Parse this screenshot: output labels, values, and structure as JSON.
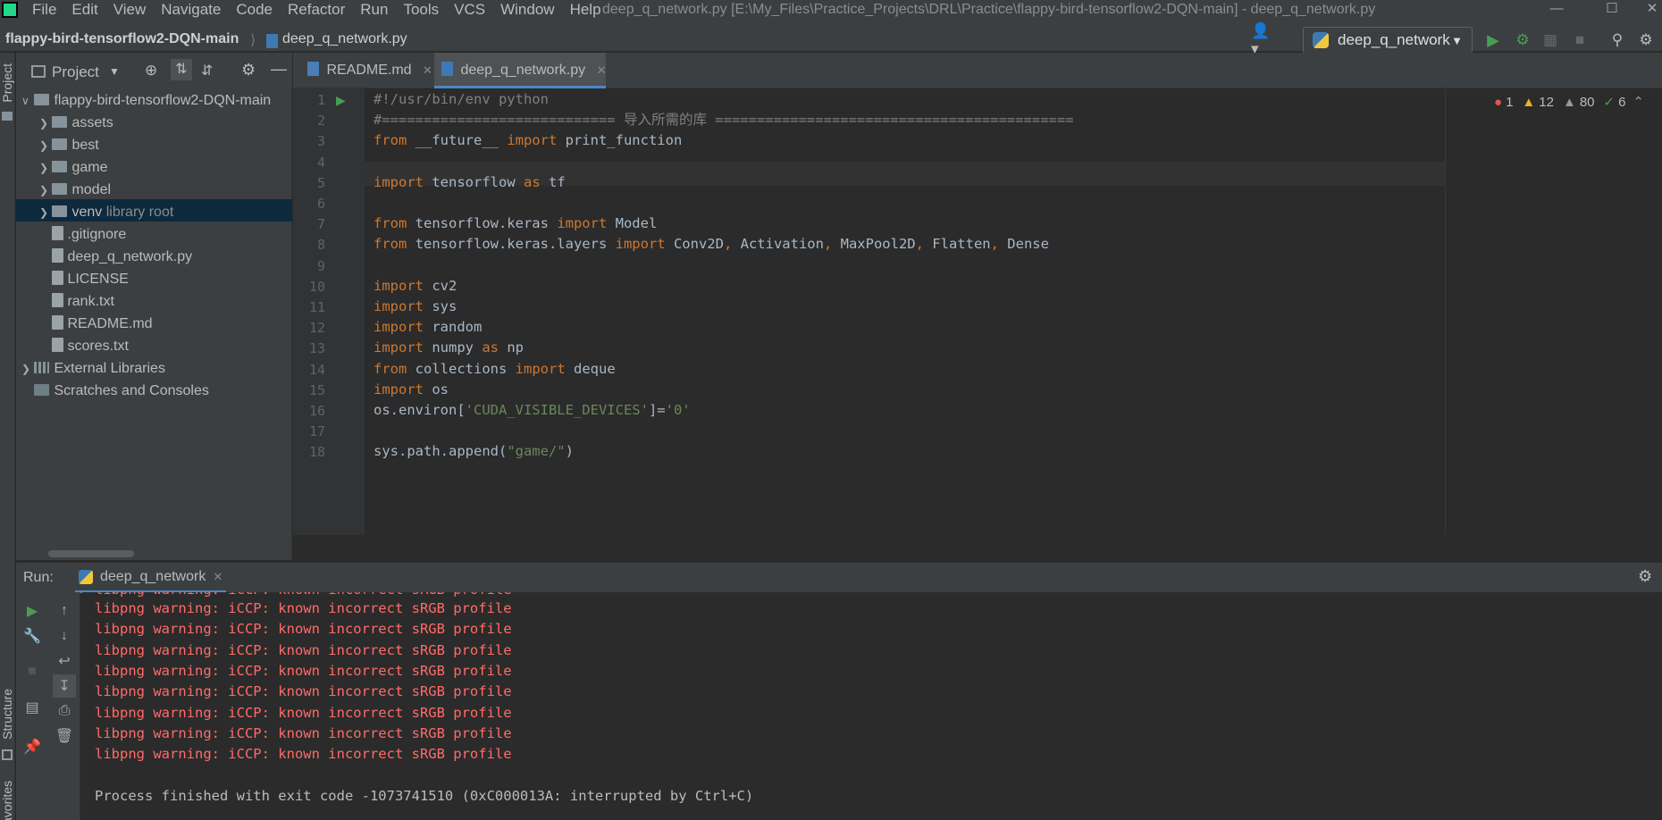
{
  "menu": {
    "items": [
      "File",
      "Edit",
      "View",
      "Navigate",
      "Code",
      "Refactor",
      "Run",
      "Tools",
      "VCS",
      "Window",
      "Help"
    ]
  },
  "window": {
    "title": "deep_q_network.py [E:\\My_Files\\Practice_Projects\\DRL\\Practice\\flappy-bird-tensorflow2-DQN-main] - deep_q_network.py"
  },
  "breadcrumb": {
    "project": "flappy-bird-tensorflow2-DQN-main",
    "file": "deep_q_network.py"
  },
  "toolbar": {
    "run_config": "deep_q_network"
  },
  "left_stripe": {
    "project_label": "Project",
    "structure_label": "Structure",
    "favorites_label": "Favorites"
  },
  "project_panel": {
    "title": "Project",
    "tree": [
      {
        "label": "flappy-bird-tensorflow2-DQN-main",
        "type": "folder",
        "depth": 0,
        "open": true
      },
      {
        "label": "assets",
        "type": "folder",
        "depth": 1
      },
      {
        "label": "best",
        "type": "folder",
        "depth": 1
      },
      {
        "label": "game",
        "type": "folder",
        "depth": 1
      },
      {
        "label": "model",
        "type": "folder",
        "depth": 1
      },
      {
        "label": "venv",
        "note": "library root",
        "type": "folder",
        "depth": 1,
        "selected": true
      },
      {
        "label": ".gitignore",
        "type": "file",
        "depth": 1
      },
      {
        "label": "deep_q_network.py",
        "type": "file",
        "depth": 1
      },
      {
        "label": "LICENSE",
        "type": "file",
        "depth": 1
      },
      {
        "label": "rank.txt",
        "type": "file",
        "depth": 1
      },
      {
        "label": "README.md",
        "type": "file",
        "depth": 1
      },
      {
        "label": "scores.txt",
        "type": "file",
        "depth": 1
      },
      {
        "label": "External Libraries",
        "type": "lib",
        "depth": 0
      },
      {
        "label": "Scratches and Consoles",
        "type": "scratch",
        "depth": 0
      }
    ]
  },
  "tabs": [
    {
      "label": "README.md",
      "active": false
    },
    {
      "label": "deep_q_network.py",
      "active": true
    }
  ],
  "inspections": {
    "errors": "1",
    "warnings": "12",
    "weak": "80",
    "ok": "6"
  },
  "editor": {
    "lines": [
      [
        [
          "#!/usr/bin/env python",
          "cm"
        ]
      ],
      [
        [
          "#============================ 导入所需的库 ===========================================",
          "cm"
        ]
      ],
      [
        [
          "from",
          "kw"
        ],
        [
          " __future__ ",
          ""
        ],
        [
          "import",
          "kw"
        ],
        [
          " print_function",
          ""
        ]
      ],
      [],
      [
        [
          "import",
          "kw"
        ],
        [
          " tensorflow ",
          ""
        ],
        [
          "as",
          "kw"
        ],
        [
          " tf",
          ""
        ]
      ],
      [],
      [
        [
          "from",
          "kw"
        ],
        [
          " tensorflow.keras ",
          ""
        ],
        [
          "import",
          "kw"
        ],
        [
          " Model",
          ""
        ]
      ],
      [
        [
          "from",
          "kw"
        ],
        [
          " tensorflow.keras.layers ",
          ""
        ],
        [
          "import",
          "kw"
        ],
        [
          " Conv2D",
          ""
        ],
        [
          ", ",
          "kw"
        ],
        [
          "Activation",
          ""
        ],
        [
          ", ",
          "kw"
        ],
        [
          "MaxPool2D",
          ""
        ],
        [
          ", ",
          "kw"
        ],
        [
          "Flatten",
          ""
        ],
        [
          ", ",
          "kw"
        ],
        [
          "Dense",
          ""
        ]
      ],
      [],
      [
        [
          "import",
          "kw"
        ],
        [
          " cv2",
          ""
        ]
      ],
      [
        [
          "import",
          "kw"
        ],
        [
          " sys",
          ""
        ]
      ],
      [
        [
          "import",
          "kw"
        ],
        [
          " random",
          ""
        ]
      ],
      [
        [
          "import",
          "kw"
        ],
        [
          " numpy ",
          ""
        ],
        [
          "as",
          "kw"
        ],
        [
          " np",
          ""
        ]
      ],
      [
        [
          "from",
          "kw"
        ],
        [
          " collections ",
          ""
        ],
        [
          "import",
          "kw"
        ],
        [
          " deque",
          ""
        ]
      ],
      [
        [
          "import",
          "kw"
        ],
        [
          " os",
          ""
        ]
      ],
      [
        [
          "os.environ[",
          ""
        ],
        [
          "'CUDA_VISIBLE_DEVICES'",
          "str"
        ],
        [
          "]=",
          ""
        ],
        [
          "'0'",
          "str"
        ]
      ],
      [],
      [
        [
          "sys.path.append(",
          ""
        ],
        [
          "\"game/\"",
          "str"
        ],
        [
          ")",
          ""
        ]
      ]
    ]
  },
  "run": {
    "label": "Run:",
    "tab": "deep_q_network",
    "console": [
      {
        "text": "libpng warning: iCCP: known incorrect sRGB profile",
        "kind": "err"
      },
      {
        "text": "libpng warning: iCCP: known incorrect sRGB profile",
        "kind": "err"
      },
      {
        "text": "libpng warning: iCCP: known incorrect sRGB profile",
        "kind": "err"
      },
      {
        "text": "libpng warning: iCCP: known incorrect sRGB profile",
        "kind": "err"
      },
      {
        "text": "libpng warning: iCCP: known incorrect sRGB profile",
        "kind": "err"
      },
      {
        "text": "libpng warning: iCCP: known incorrect sRGB profile",
        "kind": "err"
      },
      {
        "text": "libpng warning: iCCP: known incorrect sRGB profile",
        "kind": "err"
      },
      {
        "text": "libpng warning: iCCP: known incorrect sRGB profile",
        "kind": "err"
      },
      {
        "text": "",
        "kind": "ok"
      },
      {
        "text": "Process finished with exit code -1073741510 (0xC000013A: interrupted by Ctrl+C)",
        "kind": "ok"
      }
    ]
  },
  "colors": {
    "keyword": "#cc7832",
    "string": "#6a8759",
    "comment": "#808080",
    "error_text": "#ff6b68",
    "selection": "#0d293e",
    "run_green": "#499c54"
  }
}
